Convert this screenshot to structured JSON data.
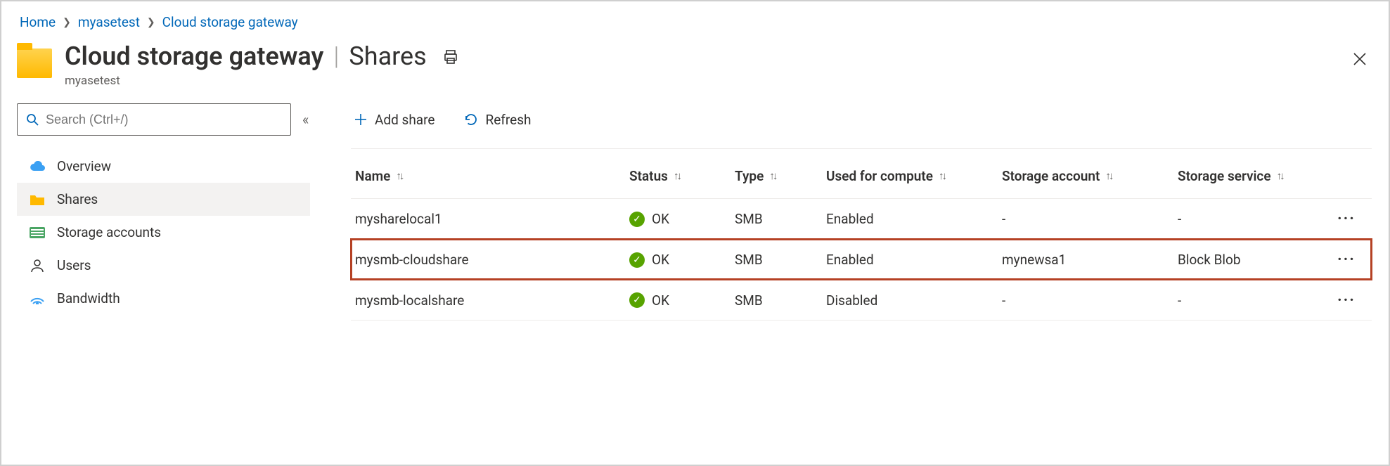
{
  "breadcrumb": [
    {
      "label": "Home"
    },
    {
      "label": "myasetest"
    },
    {
      "label": "Cloud storage gateway"
    }
  ],
  "header": {
    "title_main": "Cloud storage gateway",
    "title_sub": "Shares",
    "subtitle": "myasetest"
  },
  "search": {
    "placeholder": "Search (Ctrl+/)"
  },
  "sidebar": {
    "items": [
      {
        "label": "Overview",
        "icon": "cloud"
      },
      {
        "label": "Shares",
        "icon": "folder",
        "active": true
      },
      {
        "label": "Storage accounts",
        "icon": "storage"
      },
      {
        "label": "Users",
        "icon": "user"
      },
      {
        "label": "Bandwidth",
        "icon": "bandwidth"
      }
    ]
  },
  "toolbar": {
    "add_label": "Add share",
    "refresh_label": "Refresh"
  },
  "table": {
    "columns": {
      "name": "Name",
      "status": "Status",
      "type": "Type",
      "compute": "Used for compute",
      "account": "Storage account",
      "service": "Storage service"
    },
    "rows": [
      {
        "name": "mysharelocal1",
        "status": "OK",
        "type": "SMB",
        "compute": "Enabled",
        "account": "-",
        "service": "-",
        "highlight": false
      },
      {
        "name": "mysmb-cloudshare",
        "status": "OK",
        "type": "SMB",
        "compute": "Enabled",
        "account": "mynewsa1",
        "service": "Block Blob",
        "highlight": true
      },
      {
        "name": "mysmb-localshare",
        "status": "OK",
        "type": "SMB",
        "compute": "Disabled",
        "account": "-",
        "service": "-",
        "highlight": false
      }
    ]
  }
}
